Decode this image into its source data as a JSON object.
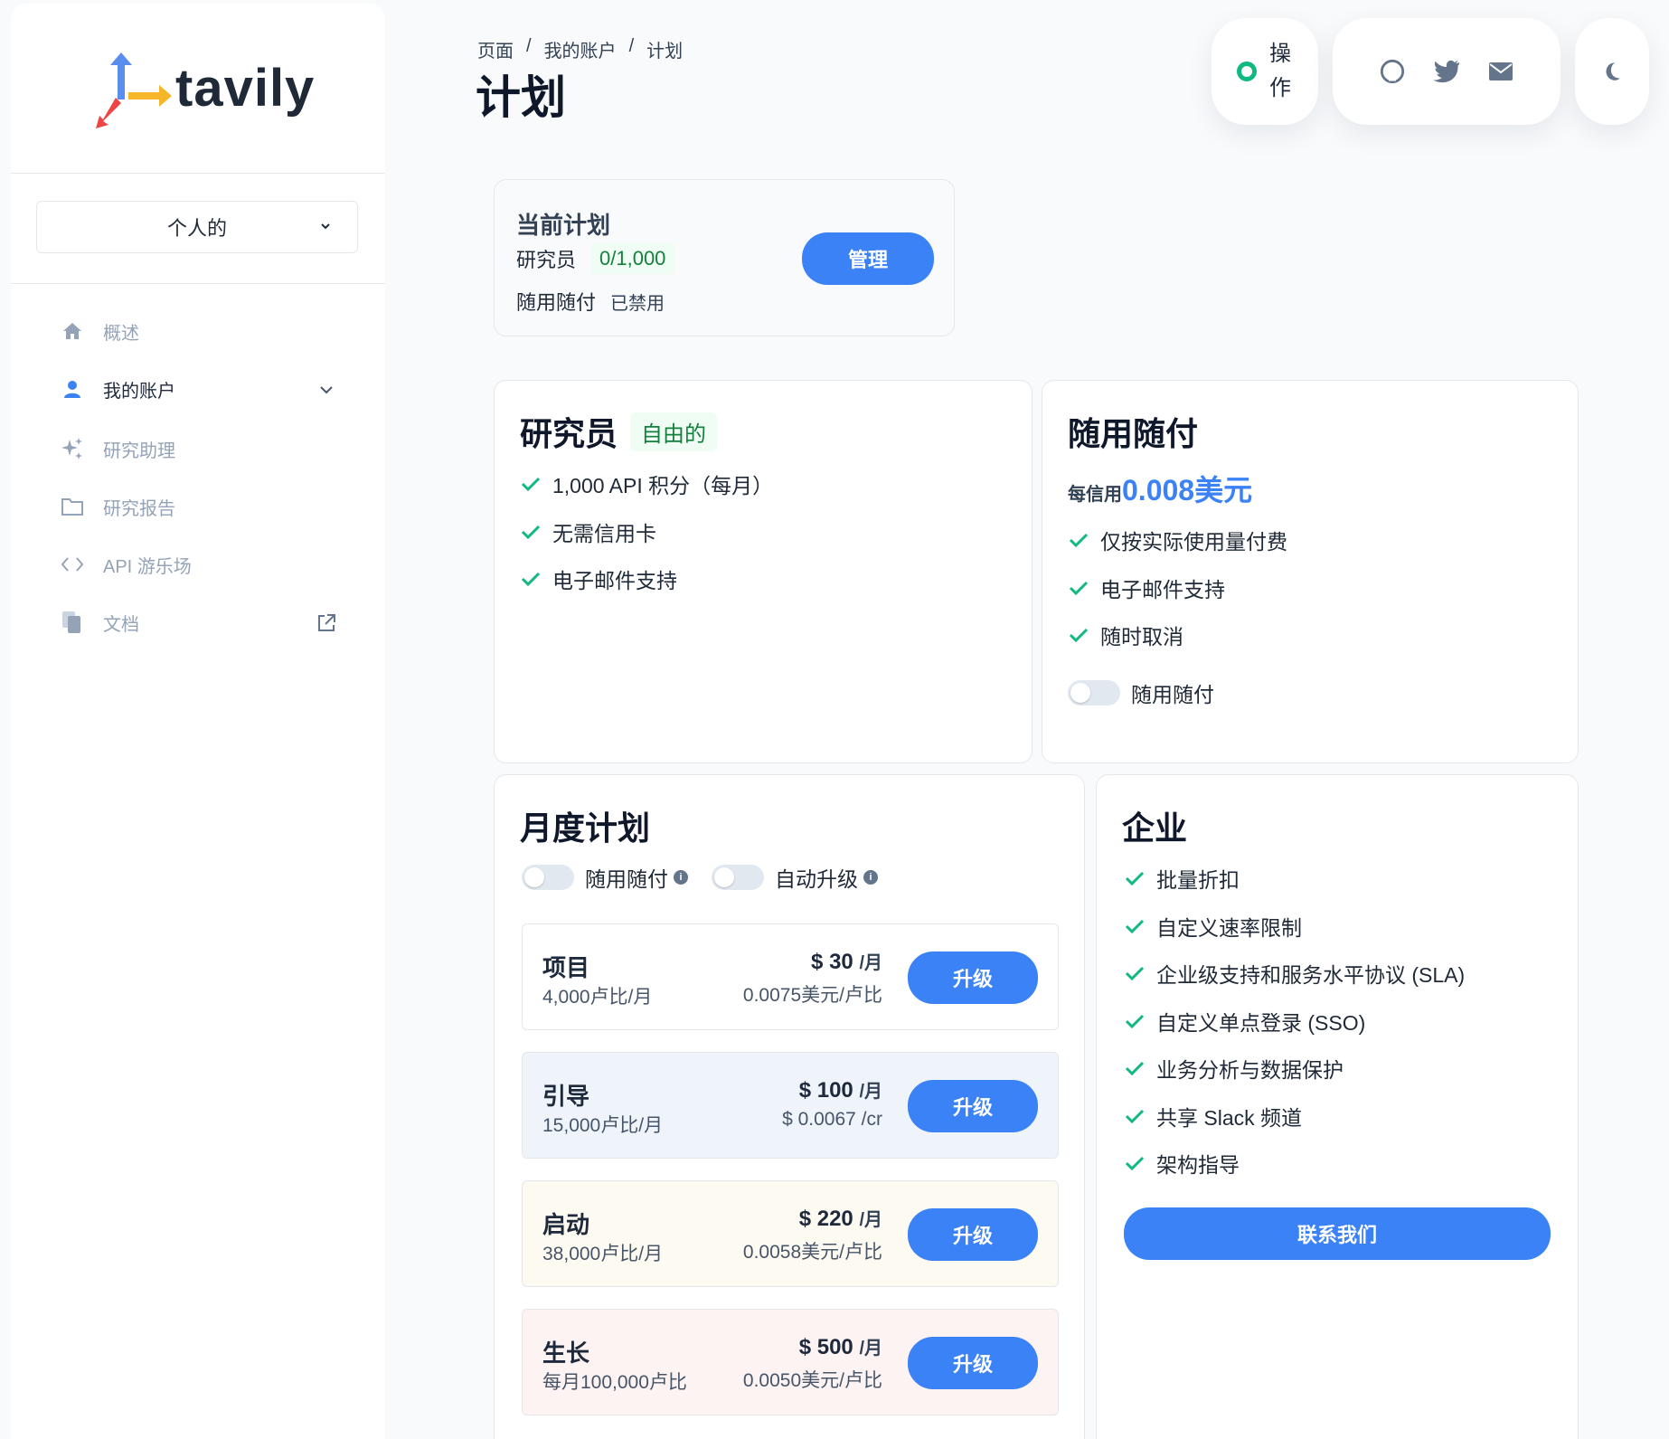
{
  "app": {
    "logo_text": "tavily"
  },
  "account_selector": {
    "value": "个人的"
  },
  "nav": [
    {
      "label": "概述",
      "icon": "home-icon"
    },
    {
      "label": "我的账户",
      "icon": "user-icon"
    },
    {
      "label": "研究助理",
      "icon": "sparkles-icon"
    },
    {
      "label": "研究报告",
      "icon": "folder-icon"
    },
    {
      "label": "API 游乐场",
      "icon": "code-icon"
    },
    {
      "label": "文档",
      "icon": "document-icon"
    }
  ],
  "breadcrumb": [
    "页面",
    "我的账户",
    "计划"
  ],
  "breadcrumb_sep": "/",
  "page_title": "计划",
  "header": {
    "status_label": "操作",
    "status_color": "#10b981"
  },
  "current_plan": {
    "title": "当前计划",
    "plan_name": "研究员",
    "usage": "0/1,000",
    "payg_label": "随用随付",
    "payg_status": "已禁用",
    "manage_label": "管理"
  },
  "researcher": {
    "title": "研究员",
    "badge": "自由的",
    "features": [
      "1,000 API 积分（每月）",
      "无需信用卡",
      "电子邮件支持"
    ]
  },
  "payg": {
    "title": "随用随付",
    "price_label": "每信用",
    "price_value": "0.008美元",
    "features": [
      "仅按实际使用量付费",
      "电子邮件支持",
      "随时取消"
    ],
    "toggle_label": "随用随付",
    "toggle_on": false
  },
  "monthly": {
    "title": "月度计划",
    "toggle1_label": "随用随付",
    "toggle2_label": "自动升级",
    "upgrade_label": "升级",
    "plans": [
      {
        "name": "项目",
        "credits": "4,000卢比/月",
        "price": "$ 30",
        "per": "/月",
        "unit": "0.0075美元/卢比",
        "bg": "#ffffff"
      },
      {
        "name": "引导",
        "credits": "15,000卢比/月",
        "price": "$ 100",
        "per": "/月",
        "unit": "$ 0.0067 /cr",
        "bg": "#eff4fb"
      },
      {
        "name": "启动",
        "credits": "38,000卢比/月",
        "price": "$ 220",
        "per": "/月",
        "unit": "0.0058美元/卢比",
        "bg": "#fdfbf1"
      },
      {
        "name": "生长",
        "credits": "每月100,000卢比",
        "price": "$ 500",
        "per": "/月",
        "unit": "0.0050美元/卢比",
        "bg": "#fdf3f3"
      }
    ]
  },
  "enterprise": {
    "title": "企业",
    "features": [
      "批量折扣",
      "自定义速率限制",
      "企业级支持和服务水平协议 (SLA)",
      "自定义单点登录 (SSO)",
      "业务分析与数据保护",
      "共享 Slack 频道",
      "架构指导"
    ],
    "contact_label": "联系我们"
  },
  "colors": {
    "accent": "#3b82f6",
    "check": "#10b981",
    "text": "#1e293b"
  }
}
